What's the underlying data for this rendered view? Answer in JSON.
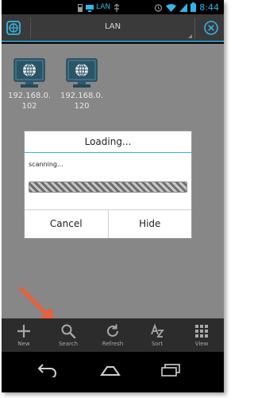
{
  "status_bar": {
    "network_label": "LAN",
    "time": "8:44",
    "icons": [
      "sdcard-icon",
      "network-icon",
      "usb-icon",
      "alarm-icon",
      "wifi-icon",
      "battery-icon"
    ]
  },
  "title_bar": {
    "title": "LAN",
    "left_icon": "lan-icon",
    "right_icon": "close-circle-icon"
  },
  "hosts": [
    {
      "label_line1": "192.168.0.",
      "label_line2": "102"
    },
    {
      "label_line1": "192.168.0.",
      "label_line2": "120"
    }
  ],
  "dialog": {
    "title": "Loading...",
    "message": "scanning...",
    "cancel_label": "Cancel",
    "hide_label": "Hide"
  },
  "toolbar": {
    "items": [
      {
        "label": "New",
        "icon": "plus-icon"
      },
      {
        "label": "Search",
        "icon": "search-icon"
      },
      {
        "label": "Refresh",
        "icon": "refresh-icon"
      },
      {
        "label": "Sort",
        "icon": "sort-icon"
      },
      {
        "label": "View",
        "icon": "grid-icon"
      }
    ]
  },
  "navigation": {
    "icons": [
      "back-icon",
      "home-icon",
      "recent-apps-icon"
    ]
  },
  "colors": {
    "accent": "#33b5e5",
    "annotation_arrow": "#e8603c",
    "dim_background": "#878787"
  }
}
